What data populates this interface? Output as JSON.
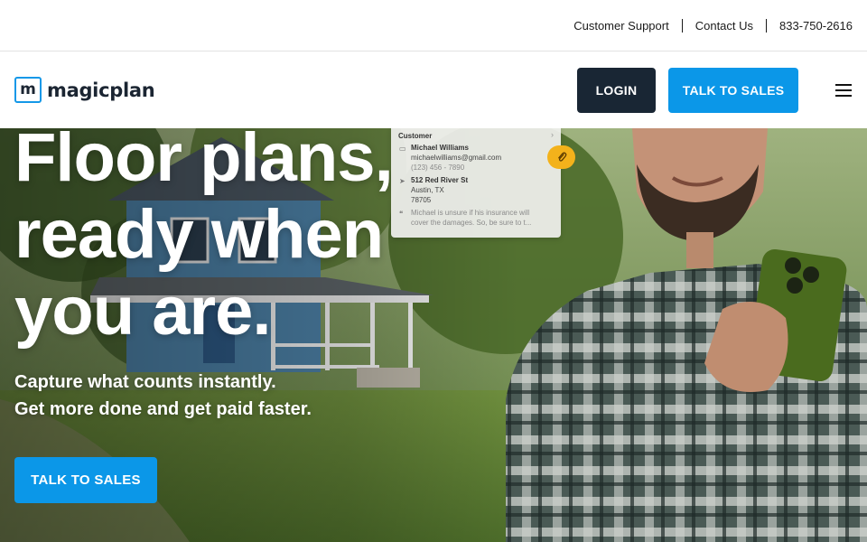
{
  "utility": {
    "support": "Customer Support",
    "contact": "Contact Us",
    "phone": "833-750-2616"
  },
  "nav": {
    "logo_mark": "m",
    "logo_text": "magicplan",
    "login": "LOGIN",
    "sales": "TALK TO SALES",
    "menu_icon": "hamburger-icon"
  },
  "hero": {
    "headline": [
      "Floor plans,",
      "ready when",
      "you are."
    ],
    "subline": [
      "Capture what counts instantly.",
      "Get more done and get paid faster."
    ],
    "cta": "TALK TO SALES"
  },
  "card": {
    "title": "Customer",
    "name": "Michael Williams",
    "email": "michaelwilliams@gmail.com",
    "phone": "(123) 456 - 7890",
    "street": "512 Red River St",
    "city": "Austin, TX",
    "zip": "78705",
    "note_1": "Michael is unsure if his insurance will",
    "note_2": "cover the damages. So, be sure to t..."
  },
  "colors": {
    "brand_blue": "#0b97e8",
    "dark_navy": "#192634",
    "badge_yellow": "#f3b21b"
  }
}
